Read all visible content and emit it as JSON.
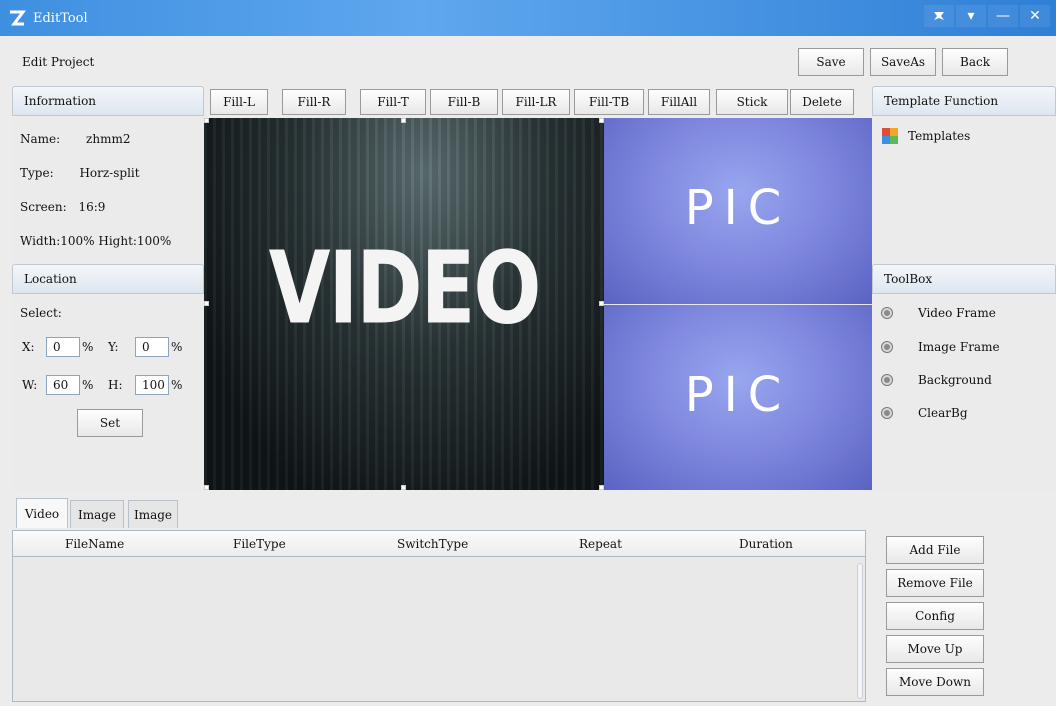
{
  "window": {
    "title": "EditTool",
    "controls": [
      "▾",
      "—",
      "✕"
    ]
  },
  "toolbar": {
    "section_label": "Edit Project",
    "save_label": "Save",
    "saveas_label": "SaveAs",
    "back_label": "Back"
  },
  "information": {
    "header": "Information",
    "name_key": "Name:",
    "name_value": "zhmm2",
    "type_key": "Type:",
    "type_value": "Horz-split",
    "screen_key": "Screen:",
    "screen_value": "16:9",
    "size_line": "Width:100% Hight:100%"
  },
  "location": {
    "header": "Location",
    "select_label": "Select:",
    "x_label": "X:",
    "x_value": "0",
    "x_unit": "%",
    "y_label": "Y:",
    "y_value": "0",
    "y_unit": "%",
    "w_label": "W:",
    "w_value": "60",
    "w_unit": "%",
    "h_label": "H:",
    "h_value": "100",
    "h_unit": "%",
    "set_label": "Set"
  },
  "fill_buttons": [
    "Fill-L",
    "Fill-R",
    "Fill-T",
    "Fill-B",
    "Fill-LR",
    "Fill-TB",
    "FillAll",
    "Stick",
    "Delete"
  ],
  "stage": {
    "video_text": "VIDEO",
    "pic1_text": "PIC",
    "pic2_text": "PIC"
  },
  "template_function": {
    "header": "Template Function",
    "item": "Templates"
  },
  "toolbox": {
    "header": "ToolBox",
    "items": [
      "Video Frame",
      "Image Frame",
      "Background",
      "ClearBg"
    ]
  },
  "bottom_tabs": [
    "Video",
    "Image",
    "Image"
  ],
  "file_table": {
    "columns": [
      "FileName",
      "FileType",
      "SwitchType",
      "Repeat",
      "Duration"
    ],
    "rows": []
  },
  "file_actions": [
    "Add File",
    "Remove File",
    "Config",
    "Move Up",
    "Move Down"
  ],
  "colors": {
    "titlebar": "#4a98e6",
    "pic_bg": "#7d86dd",
    "video_bg": "#1f2829",
    "templates_icon": [
      "#e04b3a",
      "#f4a623",
      "#3d8fe0",
      "#5cb85c"
    ]
  }
}
